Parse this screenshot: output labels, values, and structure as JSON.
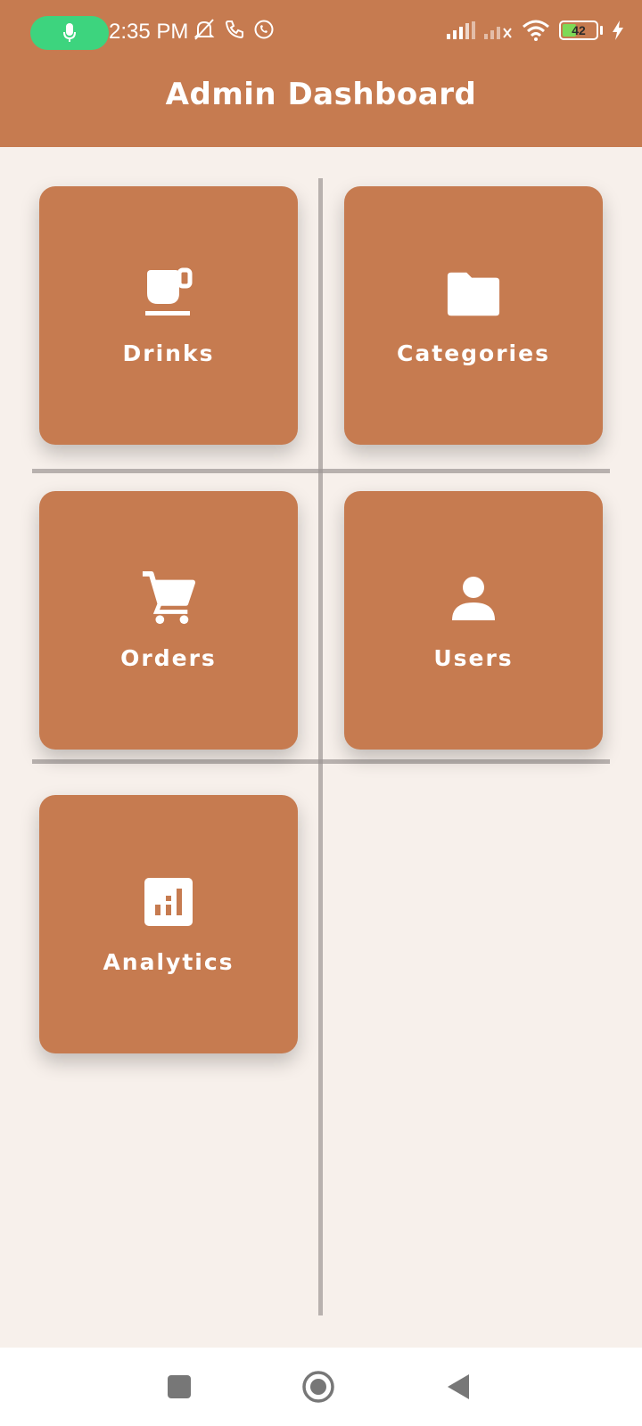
{
  "status_bar": {
    "time": "2:35 PM",
    "battery_level": "42",
    "battery_fraction": 0.42,
    "icons": [
      "microphone-icon",
      "bell-off-icon",
      "phone-icon",
      "whatsapp-icon",
      "signal-icon",
      "signal-no-service-icon",
      "wifi-icon",
      "battery-icon",
      "charging-icon"
    ]
  },
  "header": {
    "title": "Admin Dashboard"
  },
  "tiles": [
    {
      "label": "Drinks",
      "icon": "coffee-cup-icon"
    },
    {
      "label": "Categories",
      "icon": "folder-icon"
    },
    {
      "label": "Orders",
      "icon": "shopping-cart-icon"
    },
    {
      "label": "Users",
      "icon": "person-icon"
    },
    {
      "label": "Analytics",
      "icon": "analytics-icon"
    }
  ],
  "nav_bar": {
    "buttons": [
      "recents-square-icon",
      "home-circle-icon",
      "back-triangle-icon"
    ]
  },
  "colors": {
    "primary": "#c67b50",
    "background": "#f7f0eb",
    "mic_pill": "#3dd47e",
    "battery_fill": "#7ed957"
  }
}
